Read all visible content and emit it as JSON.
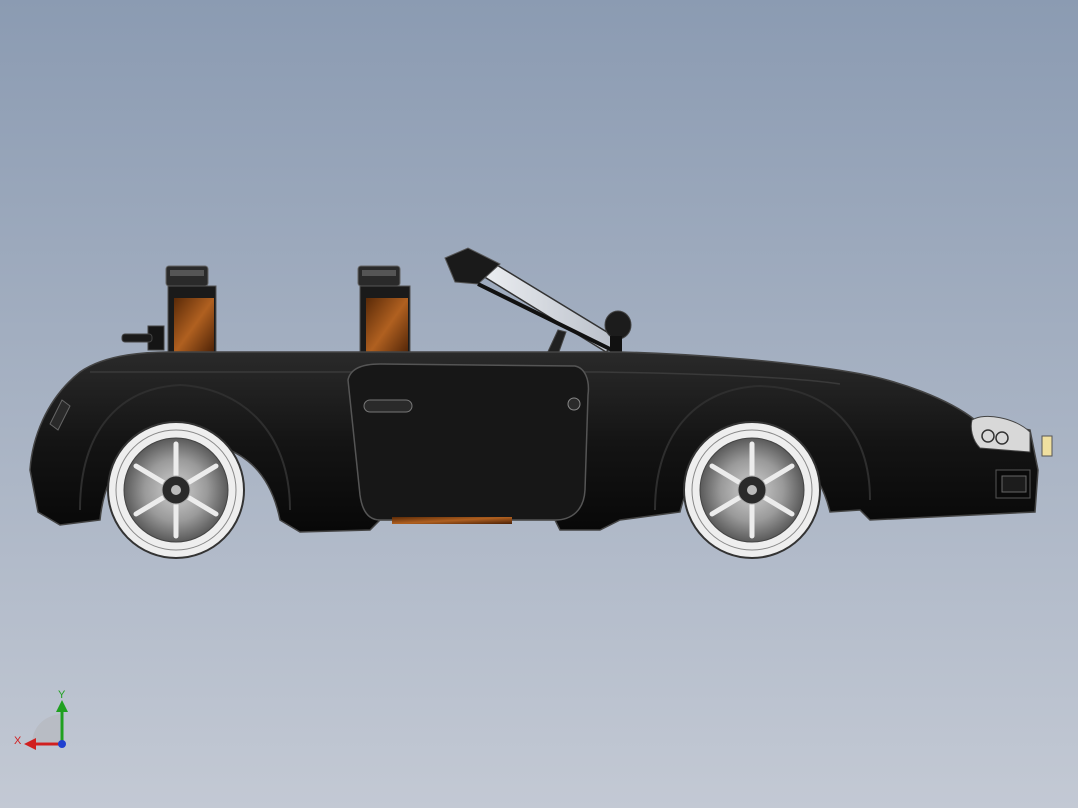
{
  "viewport": {
    "background_top": "#8b9bb2",
    "background_bottom": "#c3c9d4"
  },
  "model": {
    "body_color": "#141414",
    "rim_color": "#c8c8c8",
    "seat_insert_color": "#8a4a14",
    "windshield_color": "#d8dce2"
  },
  "triad": {
    "x_label": "X",
    "y_label": "Y",
    "x_color": "#d02020",
    "y_color": "#20a020",
    "z_color": "#2040d0"
  }
}
